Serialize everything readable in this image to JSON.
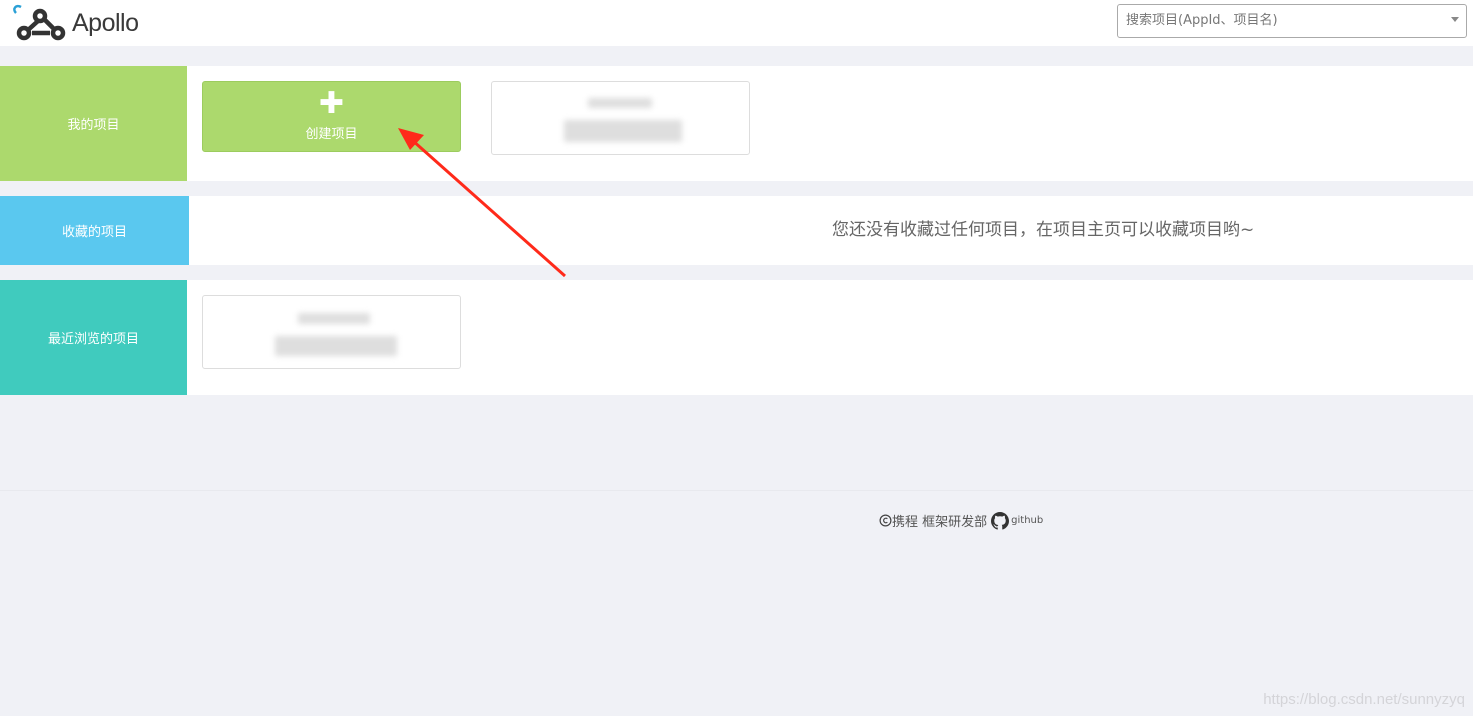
{
  "header": {
    "app_name": "Apollo",
    "search_placeholder": "搜索项目(AppId、项目名)"
  },
  "sections": {
    "my_projects": {
      "label": "我的项目",
      "color": "#acd96d",
      "create_button_label": "创建项目",
      "create_icon": "plus-icon"
    },
    "favorites": {
      "label": "收藏的项目",
      "color": "#5ac8ef",
      "empty_message": "您还没有收藏过任何项目，在项目主页可以收藏项目哟~"
    },
    "recent": {
      "label": "最近浏览的项目",
      "color": "#40cbbe"
    }
  },
  "footer": {
    "copyright_icon": "copyright-icon",
    "company": "携程 框架研发部",
    "github_icon": "github-icon",
    "github_label": "github"
  },
  "watermark": "https://blog.csdn.net/sunnyzyq",
  "annotation": {
    "arrow_color": "#ff2a1a"
  }
}
